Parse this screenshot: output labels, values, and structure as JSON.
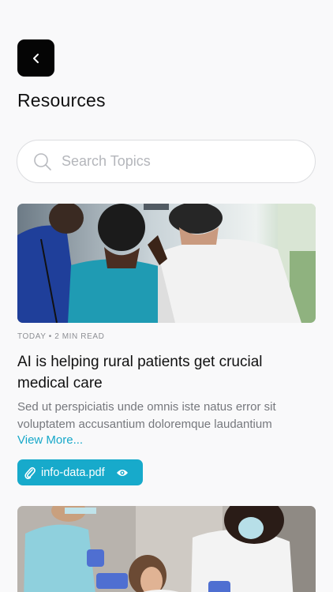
{
  "header": {
    "title": "Resources"
  },
  "search": {
    "placeholder": "Search Topics"
  },
  "articles": [
    {
      "meta": "TODAY • 2 MIN READ",
      "title": "AI is helping rural patients get crucial medical care",
      "excerpt_line1": "Sed ut perspiciatis unde omnis iste natus error sit",
      "excerpt_line2": "voluptatem accusantium doloremque laudantium",
      "view_more": "View More...",
      "attachment": "info-data.pdf"
    }
  ],
  "colors": {
    "accent": "#17aacb",
    "link": "#17a8c9",
    "background": "#f9f9fa",
    "back_button": "#050505"
  },
  "icons": [
    "chevron-left-icon",
    "search-icon",
    "paperclip-icon",
    "eye-icon"
  ]
}
